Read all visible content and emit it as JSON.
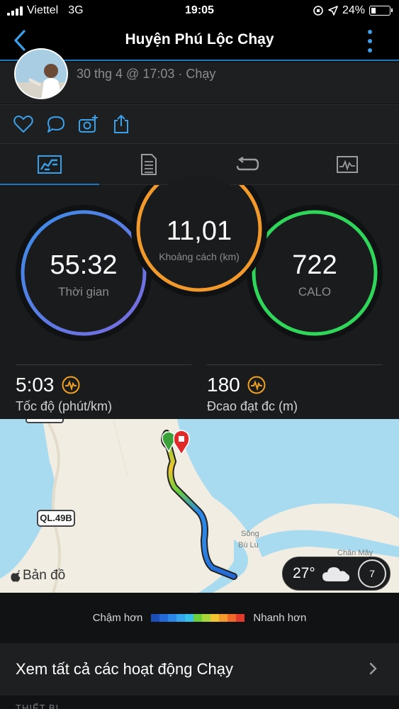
{
  "status_bar": {
    "carrier": "Viettel",
    "network": "3G",
    "time": "19:05",
    "battery": "24%"
  },
  "nav": {
    "title": "Huyện Phú Lộc Chạy"
  },
  "activity": {
    "date_meta": "30 thg 4 @ 17:03 · Chạy"
  },
  "tabs": [
    {
      "icon": "stats-icon",
      "active": true
    },
    {
      "icon": "document-icon",
      "active": false
    },
    {
      "icon": "laps-icon",
      "active": false
    },
    {
      "icon": "graph-icon",
      "active": false
    }
  ],
  "rings": {
    "time": {
      "value": "55:32",
      "label": "Thời gian"
    },
    "distance": {
      "value": "11,01",
      "label": "Khoảng cách (km)"
    },
    "calories": {
      "value": "722",
      "label": "CALO"
    }
  },
  "metrics": {
    "pace": {
      "value": "5:03",
      "label": "Tốc độ (phút/km)"
    },
    "elevation": {
      "value": "180",
      "label": "Đcao đạt đc (m)"
    }
  },
  "map": {
    "road_shield": "QL.49B",
    "river_label_1": "Sông",
    "river_label_2": "Bù Lu",
    "place_label": "Chân Mây",
    "attribution": "Bản đồ",
    "weather_temp": "27°",
    "wind_speed": "7"
  },
  "legend": {
    "slower": "Chậm hơn",
    "faster": "Nhanh hơn",
    "colors": [
      "#1d4fb8",
      "#2569d6",
      "#2c86e6",
      "#35a5f0",
      "#36c2e8",
      "#6ccf3b",
      "#a7d53a",
      "#f0c531",
      "#f29a2d",
      "#ef6a2a",
      "#e23a2a"
    ]
  },
  "footer": {
    "see_all": "Xem tất cả các hoạt động Chạy",
    "section": "THIẾT BỊ"
  },
  "colors": {
    "accent": "#1a78c2",
    "ring_time": "#3a8ee8",
    "ring_distance": "#f19a2b",
    "ring_calories": "#2fd65a"
  }
}
